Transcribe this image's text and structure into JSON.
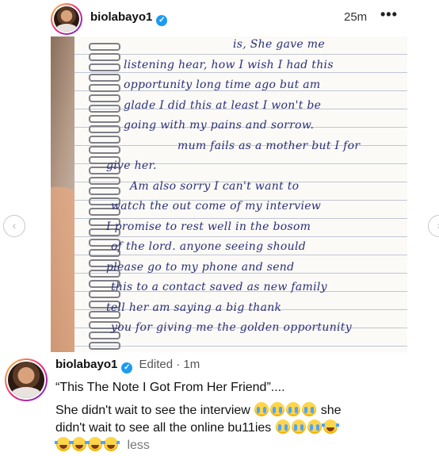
{
  "header": {
    "username": "biolabayo1",
    "time": "25m",
    "more_label": "•••"
  },
  "photo": {
    "note_lines": [
      "is, She gave me",
      "listening hear, how I wish I had this",
      "opportunity long time ago but am",
      "glade I did this at least I won't be",
      "going with my pains and sorrow.",
      "mum fails as a mother but I for",
      "give her.",
      "Am also sorry I can't want to",
      "watch the out come of my interview",
      "I promise to rest well in the bosom",
      "of the lord. anyone seeing should",
      "please go to my phone and send",
      "this to a contact saved as new family",
      "tell her am saying a big thank",
      "you for giving me the golden opportunity"
    ]
  },
  "nav": {
    "prev_label": "‹",
    "next_label": "›"
  },
  "caption": {
    "username": "biolabayo1",
    "edited": "Edited · 1m",
    "line1": "“This The Note I Got From Her Friend”....",
    "line2_text": "She didn't wait to see the interview",
    "line2_end": "she",
    "line3_text": "didn't wait to see all the online bu11ies",
    "more_label": "less"
  },
  "colors": {
    "verified": "#1d9bf0",
    "ink": "#2a2f78"
  },
  "icons": {
    "verified": "verified-badge-icon",
    "cry": "loudly-crying-face-emoji",
    "laugh": "tears-of-joy-emoji"
  }
}
